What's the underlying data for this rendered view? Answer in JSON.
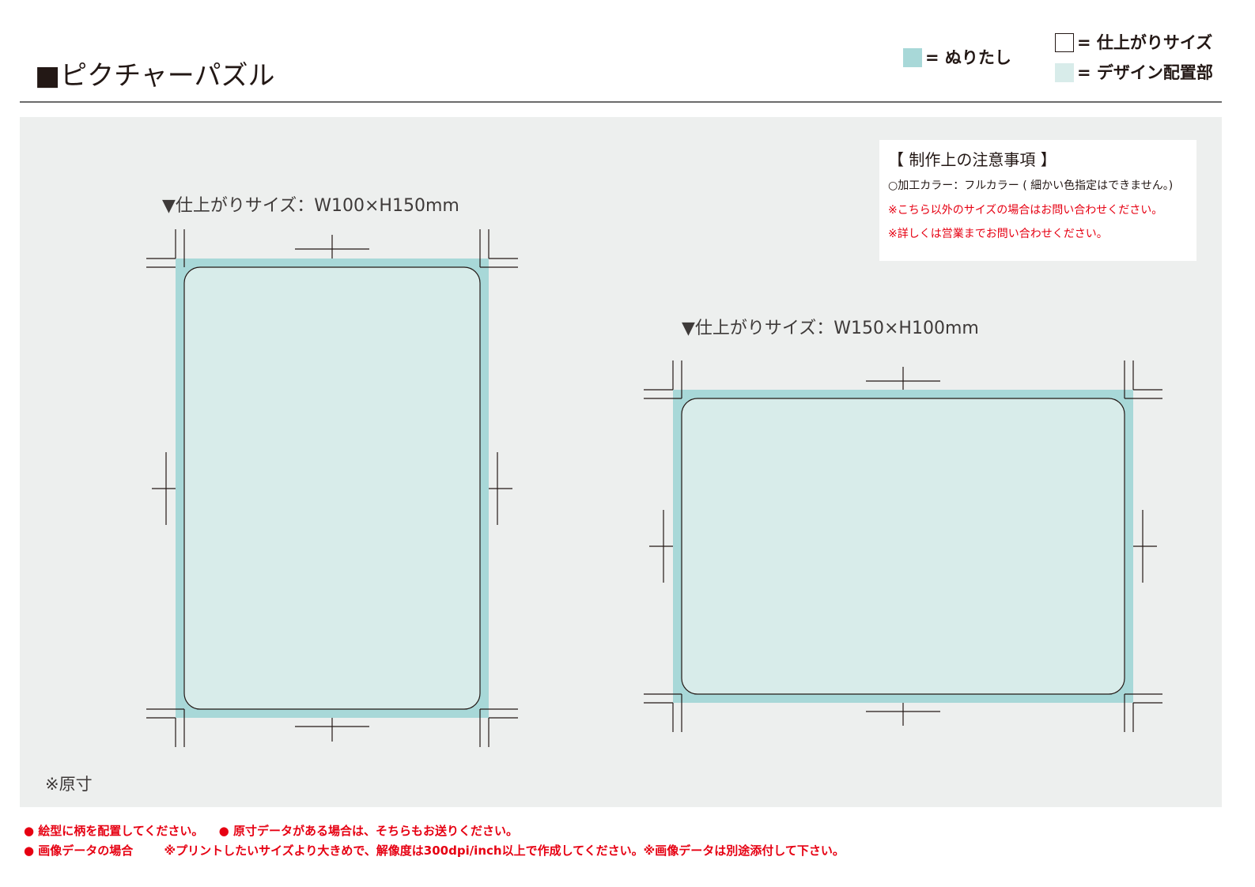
{
  "header": {
    "title": "■ピクチャーパズル"
  },
  "legend": {
    "bleed_label": "= ぬりたし",
    "finish_label": "= 仕上がりサイズ",
    "design_label": "= デザイン配置部",
    "colors": {
      "bleed": "#a8d8d8",
      "finish": "#ffffff",
      "design": "#d8ecea"
    }
  },
  "notes": {
    "title": "【 制作上の注意事項 】",
    "line1": "○加工カラー：フルカラー ( 細かい色指定はできません。)",
    "line2": "※こちら以外のサイズの場合はお問い合わせください。",
    "line3": "※詳しくは営業までお問い合わせください。"
  },
  "templates": [
    {
      "label": "▼仕上がりサイズ：W100×H150mm",
      "orientation": "portrait"
    },
    {
      "label": "▼仕上がりサイズ：W150×H100mm",
      "orientation": "landscape"
    }
  ],
  "canvas_note": "※原寸",
  "footer": {
    "line1_a": "● 絵型に柄を配置してください。",
    "line1_b": "● 原寸データがある場合は、そちらもお送りください。",
    "line2_a": "● 画像データの場合",
    "line2_b": "※プリントしたいサイズより大きめで、解像度は300dpi/inch以上で作成してください。※画像データは別途添付して下さい。"
  },
  "colors": {
    "canvas_bg": "#edefee",
    "rule": "#6b6b6b",
    "warning_red": "#e60012",
    "text_dark": "#231815"
  }
}
